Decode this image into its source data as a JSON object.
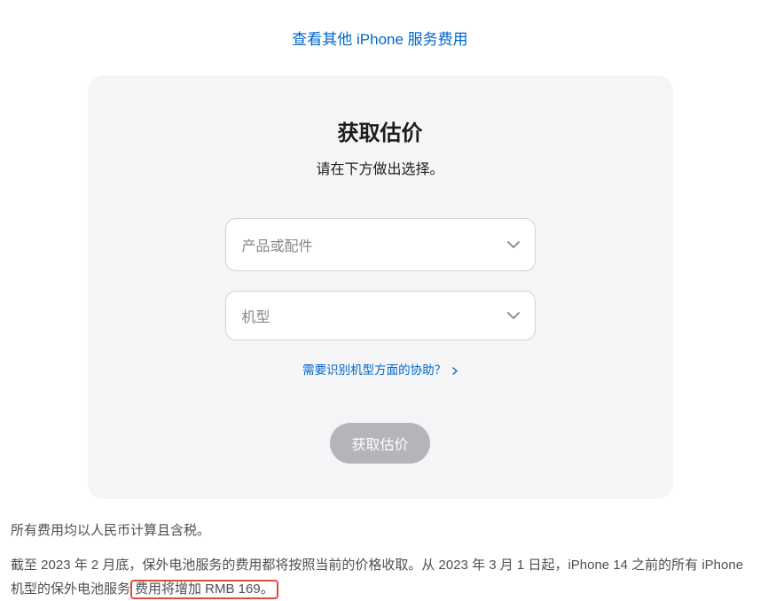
{
  "top": {
    "link_label": "查看其他 iPhone 服务费用"
  },
  "card": {
    "title": "获取估价",
    "subtitle": "请在下方做出选择。",
    "select_product_placeholder": "产品或配件",
    "select_model_placeholder": "机型",
    "help_link_label": "需要识别机型方面的协助？",
    "submit_label": "获取估价"
  },
  "footer": {
    "line1": "所有费用均以人民币计算且含税。",
    "line2_prefix": "截至 2023 年 2 月底，保外电池服务的费用都将按照当前的价格收取。从 2023 年 3 月 1 日起，iPhone 14 之前的所有 iPhone 机型的保外电池服务",
    "line2_highlight": "费用将增加 RMB 169。"
  }
}
